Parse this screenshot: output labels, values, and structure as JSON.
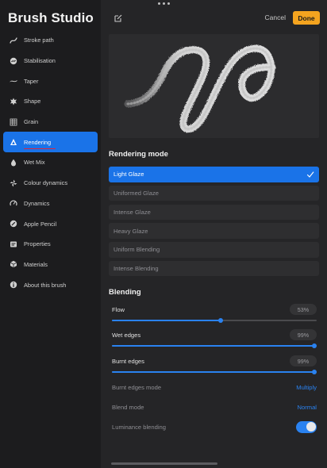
{
  "app_title": "Brush Studio",
  "sidebar": {
    "items": [
      {
        "label": "Stroke path",
        "icon": "stroke-path-icon"
      },
      {
        "label": "Stabilisation",
        "icon": "stabilisation-icon"
      },
      {
        "label": "Taper",
        "icon": "taper-icon"
      },
      {
        "label": "Shape",
        "icon": "shape-icon"
      },
      {
        "label": "Grain",
        "icon": "grain-icon"
      },
      {
        "label": "Rendering",
        "icon": "rendering-icon",
        "active": true
      },
      {
        "label": "Wet Mix",
        "icon": "wet-mix-icon"
      },
      {
        "label": "Colour dynamics",
        "icon": "colour-dynamics-icon"
      },
      {
        "label": "Dynamics",
        "icon": "dynamics-icon"
      },
      {
        "label": "Apple Pencil",
        "icon": "apple-pencil-icon"
      },
      {
        "label": "Properties",
        "icon": "properties-icon"
      },
      {
        "label": "Materials",
        "icon": "materials-icon"
      },
      {
        "label": "About this brush",
        "icon": "info-icon"
      }
    ]
  },
  "header": {
    "cancel_label": "Cancel",
    "done_label": "Done",
    "edit_icon": "edit-icon"
  },
  "rendering_mode": {
    "title": "Rendering mode",
    "options": [
      {
        "label": "Light Glaze",
        "selected": true
      },
      {
        "label": "Uniformed Glaze"
      },
      {
        "label": "Intense Glaze"
      },
      {
        "label": "Heavy Glaze"
      },
      {
        "label": "Uniform Blending"
      },
      {
        "label": "Intense Blending"
      }
    ]
  },
  "blending": {
    "title": "Blending",
    "sliders": [
      {
        "label": "Flow",
        "value_text": "53%",
        "value": 0.53
      },
      {
        "label": "Wet edges",
        "value_text": "99%",
        "value": 0.99
      },
      {
        "label": "Burnt edges",
        "value_text": "99%",
        "value": 0.99
      }
    ],
    "burnt_edges_mode": {
      "label": "Burnt edges mode",
      "value": "Multiply"
    },
    "blend_mode": {
      "label": "Blend mode",
      "value": "Normal"
    },
    "luminance_blending": {
      "label": "Luminance blending",
      "on": true
    }
  },
  "colors": {
    "accent": "#1a73e8",
    "done": "#f4a41f",
    "sidebar_bg": "#1c1c1e",
    "panel_bg": "#252527"
  }
}
